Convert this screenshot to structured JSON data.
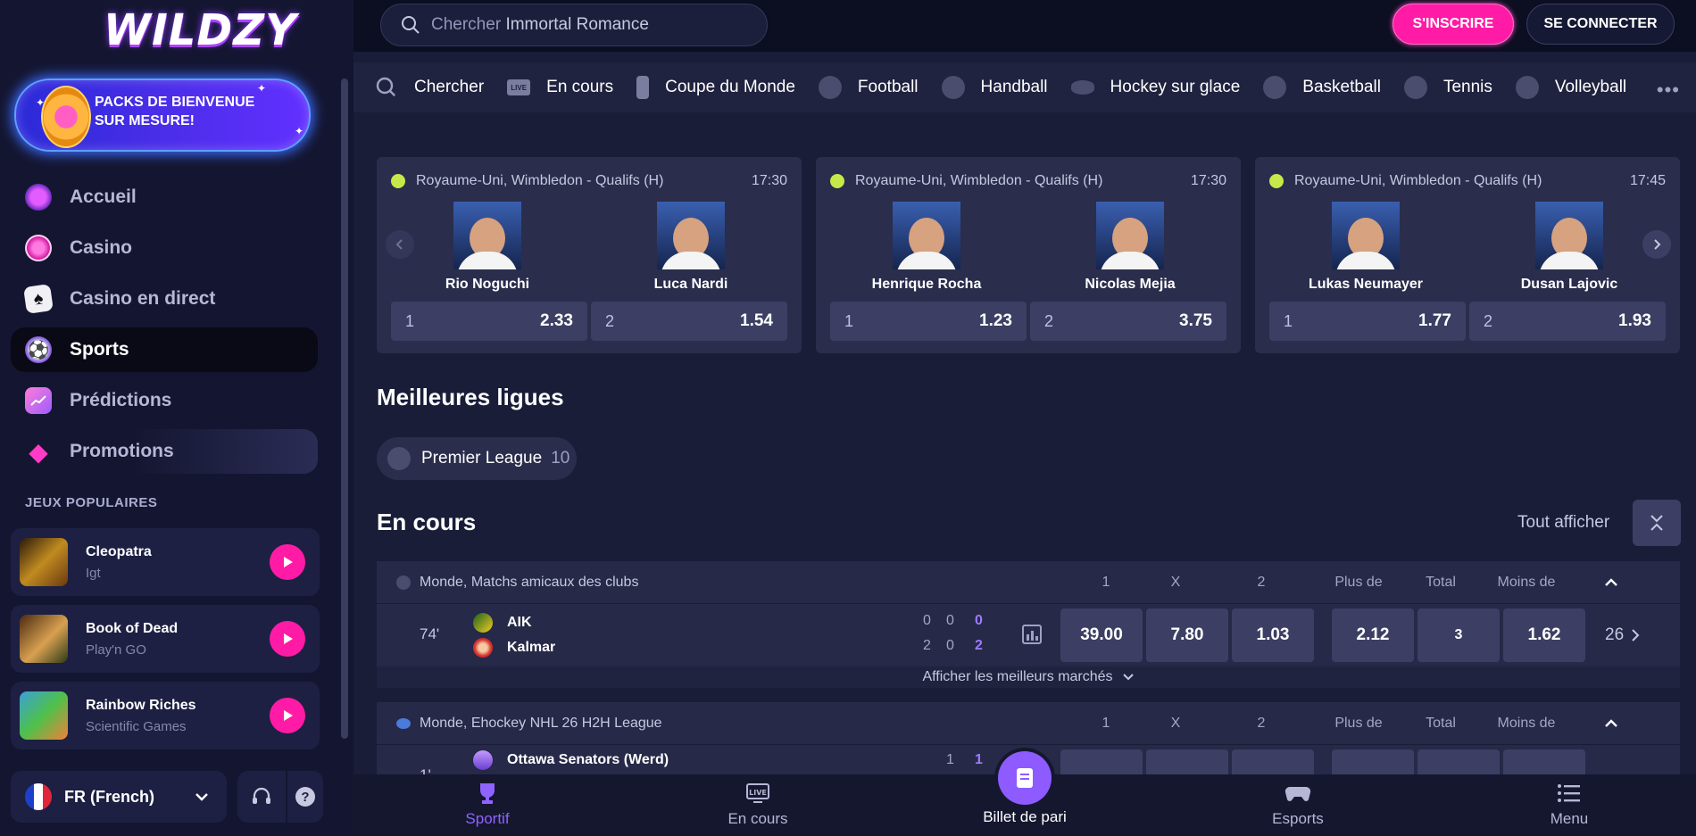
{
  "brand": {
    "logo": "WILDZY"
  },
  "promo": {
    "title": "PACKS DE BIENVENUE SUR MESURE!"
  },
  "nav": [
    {
      "label": "Accueil",
      "icon": "orb-icon"
    },
    {
      "label": "Casino",
      "icon": "chip-icon"
    },
    {
      "label": "Casino en direct",
      "icon": "cards-icon"
    },
    {
      "label": "Sports",
      "icon": "soccer-ball-icon",
      "active": true
    },
    {
      "label": "Prédictions",
      "icon": "chart-icon"
    },
    {
      "label": "Promotions",
      "icon": "diamond-icon"
    }
  ],
  "popular": {
    "title": "JEUX POPULAIRES",
    "games": [
      {
        "name": "Cleopatra",
        "provider": "Igt"
      },
      {
        "name": "Book of Dead",
        "provider": "Play'n GO"
      },
      {
        "name": "Rainbow Riches",
        "provider": "Scientific Games"
      }
    ]
  },
  "footer": {
    "language": "FR (French)"
  },
  "topbar": {
    "search_placeholder": "Chercher",
    "search_suggestion": "Immortal Romance",
    "register": "S'INSCRIRE",
    "login": "SE CONNECTER"
  },
  "sports_nav": [
    {
      "label": "Chercher",
      "icon": "search-icon"
    },
    {
      "label": "En cours",
      "icon": "live-icon"
    },
    {
      "label": "Coupe du Monde",
      "icon": "trophy-icon"
    },
    {
      "label": "Football",
      "icon": "soccer-ball-icon"
    },
    {
      "label": "Handball",
      "icon": "handball-icon"
    },
    {
      "label": "Hockey sur glace",
      "icon": "puck-icon"
    },
    {
      "label": "Basketball",
      "icon": "basketball-icon"
    },
    {
      "label": "Tennis",
      "icon": "tennis-ball-icon"
    },
    {
      "label": "Volleyball",
      "icon": "volleyball-icon"
    }
  ],
  "featured": [
    {
      "league": "Royaume-Uni, Wimbledon - Qualifs (H)",
      "time": "17:30",
      "p1": "Rio Noguchi",
      "p2": "Luca Nardi",
      "o1_label": "1",
      "o1": "2.33",
      "o2_label": "2",
      "o2": "1.54"
    },
    {
      "league": "Royaume-Uni, Wimbledon - Qualifs (H)",
      "time": "17:30",
      "p1": "Henrique Rocha",
      "p2": "Nicolas Mejia",
      "o1_label": "1",
      "o1": "1.23",
      "o2_label": "2",
      "o2": "3.75"
    },
    {
      "league": "Royaume-Uni, Wimbledon - Qualifs (H)",
      "time": "17:45",
      "p1": "Lukas Neumayer",
      "p2": "Dusan Lajovic",
      "o1_label": "1",
      "o1": "1.77",
      "o2_label": "2",
      "o2": "1.93"
    }
  ],
  "top_leagues": {
    "title": "Meilleures ligues",
    "chip": "Premier League",
    "count": "10"
  },
  "live": {
    "title": "En cours",
    "show_all": "Tout afficher",
    "cols": {
      "c1": "1",
      "cx": "X",
      "c2": "2",
      "over": "Plus de",
      "total": "Total",
      "under": "Moins de"
    },
    "groups": [
      {
        "league": "Monde, Matchs amicaux des clubs",
        "minute": "74'",
        "team1": "AIK",
        "team2": "Kalmar",
        "s1a": "0",
        "s1b": "0",
        "s1": "0",
        "s2a": "2",
        "s2b": "0",
        "s2": "2",
        "odds": {
          "o1": "39.00",
          "ox": "7.80",
          "o2": "1.03",
          "over": "2.12",
          "total": "3",
          "under": "1.62"
        },
        "more": "26",
        "best": "Afficher les meilleurs marchés"
      },
      {
        "league": "Monde, Ehockey NHL 26 H2H League",
        "minute": "1'",
        "team1": "Ottawa Senators (Werd)",
        "s1b": "1",
        "s1": "1"
      }
    ]
  },
  "bottom": [
    {
      "label": "Sportif",
      "active": true
    },
    {
      "label": "En cours"
    },
    {
      "label": "Billet de pari"
    },
    {
      "label": "Esports"
    },
    {
      "label": "Menu"
    }
  ],
  "colors": {
    "accent": "#ff1ba6",
    "purple": "#8d5bff",
    "bg": "#1a1d38"
  }
}
